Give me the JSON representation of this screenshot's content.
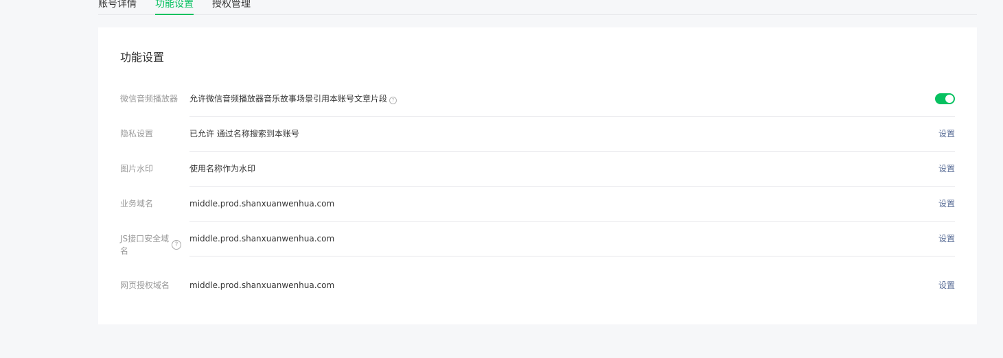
{
  "tabs": [
    {
      "label": "账号详情"
    },
    {
      "label": "功能设置"
    },
    {
      "label": "授权管理"
    }
  ],
  "active_tab": "功能设置",
  "card": {
    "title": "功能设置",
    "rows": [
      {
        "label": "微信音频播放器",
        "value": "允许微信音频播放器音乐故事场景引用本账号文章片段",
        "control": "toggle",
        "toggle_on": true
      },
      {
        "label": "隐私设置",
        "value": "已允许 通过名称搜索到本账号",
        "action": "设置"
      },
      {
        "label": "图片水印",
        "value": "使用名称作为水印",
        "action": "设置"
      },
      {
        "label": "业务域名",
        "value": "middle.prod.shanxuanwenhua.com",
        "action": "设置"
      },
      {
        "label_line1": "JS接口安全域",
        "label_line2": "名",
        "value": "middle.prod.shanxuanwenhua.com",
        "action": "设置"
      },
      {
        "label": "网页授权域名",
        "value": "middle.prod.shanxuanwenhua.com",
        "action": "设置"
      }
    ]
  },
  "help_glyph": "?",
  "colors": {
    "accent": "#07c160",
    "link": "#576b95",
    "label": "#9a9a9a",
    "background": "#f6f7f9"
  }
}
